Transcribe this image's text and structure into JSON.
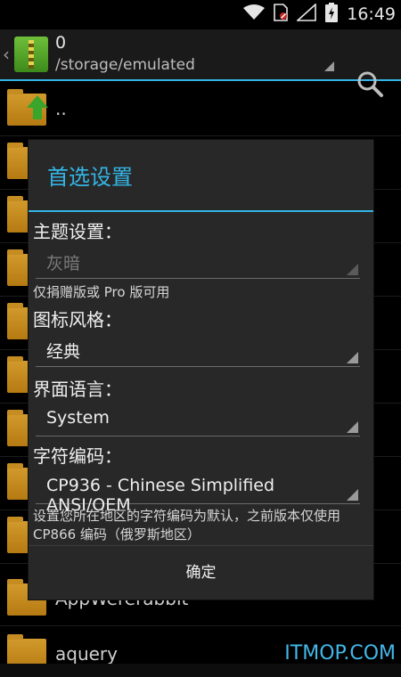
{
  "status_bar": {
    "time": "16:49",
    "icons": [
      "wifi-icon",
      "sim-blocked-icon",
      "signal-icon",
      "battery-charging-icon"
    ]
  },
  "action_bar": {
    "title": "0",
    "path": "/storage/emulated",
    "icons": [
      "back-chevron-icon",
      "app-archive-icon",
      "search-icon"
    ]
  },
  "file_list": {
    "items": [
      {
        "name": ".."
      },
      {
        "name": ""
      },
      {
        "name": ""
      },
      {
        "name": ""
      },
      {
        "name": ""
      },
      {
        "name": ""
      },
      {
        "name": ""
      },
      {
        "name": ""
      },
      {
        "name": ""
      },
      {
        "name": ""
      },
      {
        "name": "AppWererabbit"
      },
      {
        "name": "aquery"
      }
    ]
  },
  "dialog": {
    "title": "首选设置",
    "theme_label": "主题设置：",
    "theme_value": "灰暗",
    "theme_note": "仅捐赠版或 Pro 版可用",
    "icon_style_label": "图标风格：",
    "icon_style_value": "经典",
    "language_label": "界面语言：",
    "language_value": "System",
    "encoding_label": "字符编码：",
    "encoding_value": "CP936 - Chinese Simplified ANSI/OEM",
    "encoding_note": "设置您所在地区的字符编码为默认，之前版本仅使用 CP866 编码（俄罗斯地区）",
    "ok_label": "确定"
  },
  "watermark": "ITMOP.COM",
  "colors": {
    "accent": "#33b5e5",
    "dialog_bg": "#282828",
    "folder": "#c58c22"
  }
}
